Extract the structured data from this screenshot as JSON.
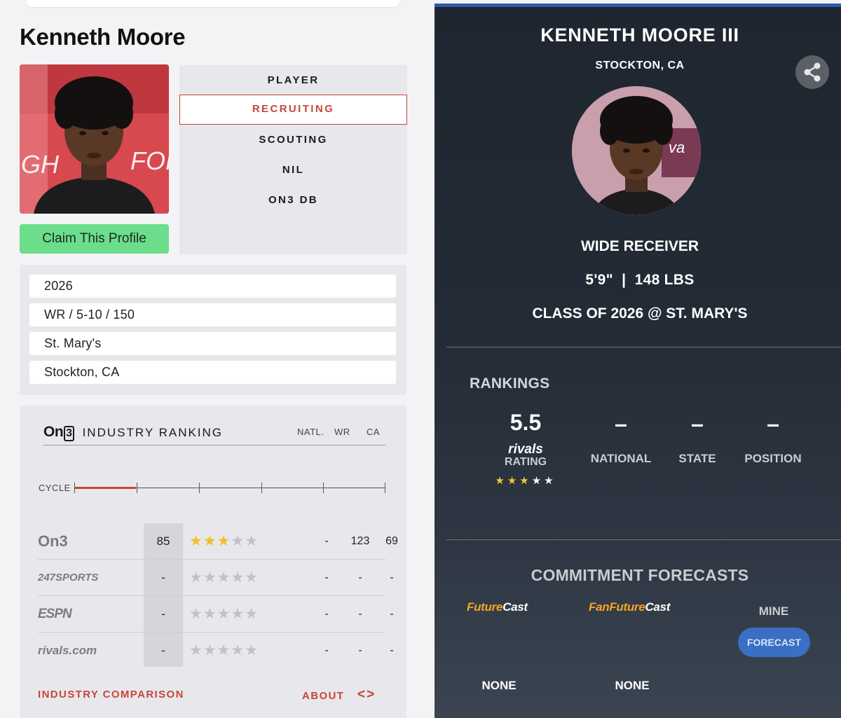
{
  "left": {
    "player_name": "Kenneth Moore",
    "claim_button": "Claim This Profile",
    "tabs": [
      {
        "label": "PLAYER",
        "active": false
      },
      {
        "label": "RECRUITING",
        "active": true
      },
      {
        "label": "SCOUTING",
        "active": false
      },
      {
        "label": "NIL",
        "active": false
      },
      {
        "label": "ON3 DB",
        "active": false
      }
    ],
    "info": [
      "2026",
      "WR / 5-10 / 150",
      "St. Mary's",
      "Stockton, CA"
    ],
    "ranking": {
      "logo": "On",
      "logo_num": "3",
      "title": "INDUSTRY RANKING",
      "columns": [
        "NATL.",
        "WR",
        "CA"
      ],
      "cycle_label": "CYCLE",
      "rows": [
        {
          "source": "On3",
          "score": "85",
          "stars": 3,
          "natl": "-",
          "pos": "123",
          "state": "69"
        },
        {
          "source": "247SPORTS",
          "score": "-",
          "stars": 0,
          "natl": "-",
          "pos": "-",
          "state": "-"
        },
        {
          "source": "ESPN",
          "score": "-",
          "stars": 0,
          "natl": "-",
          "pos": "-",
          "state": "-"
        },
        {
          "source": "rivals.com",
          "score": "-",
          "stars": 0,
          "natl": "-",
          "pos": "-",
          "state": "-"
        }
      ],
      "compare_link": "INDUSTRY COMPARISON",
      "about_link": "ABOUT",
      "arrows": "<>"
    }
  },
  "right": {
    "name": "KENNETH MOORE III",
    "city": "STOCKTON, CA",
    "position": "WIDE RECEIVER",
    "height_weight": "5'9\"  |  148 LBS",
    "class": "CLASS OF 2026 @ ST. MARY'S",
    "rankings_title": "RANKINGS",
    "rating_value": "5.5",
    "rating_brand": "rivals",
    "rating_label": "RATING",
    "rating_stars": 3,
    "national_value": "–",
    "national_label": "NATIONAL",
    "state_value": "–",
    "state_label": "STATE",
    "position_value": "–",
    "position_label": "POSITION",
    "commitment_title": "COMMITMENT FORECASTS",
    "futurecast_a": "Future",
    "futurecast_b": "Cast",
    "fanfuturecast_a": "FanFuture",
    "fanfuturecast_b": "Cast",
    "mine_label": "MINE",
    "forecast_button": "FORECAST",
    "none_1": "NONE",
    "none_2": "NONE"
  },
  "colors": {
    "accent_red": "#c7463a",
    "claim_green": "#6bdd8b",
    "star_gold": "#f3bf2b",
    "forecast_blue": "#3a6fc4",
    "futurecast_orange": "#f3a523"
  }
}
